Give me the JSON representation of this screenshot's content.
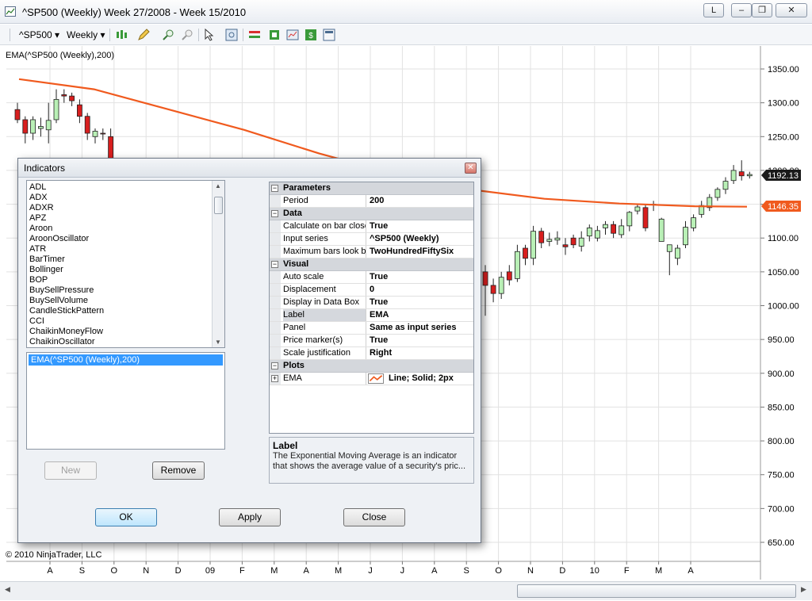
{
  "window": {
    "title": "^SP500 (Weekly)  Week 27/2008 - Week 15/2010",
    "btn_layout": "L"
  },
  "toolbar": {
    "instrument": "^SP500",
    "interval": "Weekly"
  },
  "chart": {
    "indicator_label": "EMA(^SP500 (Weekly),200)",
    "copyright": "© 2010 NinjaTrader, LLC",
    "last_price": "1192.13",
    "ema_value": "1146.35",
    "colors": {
      "up": "#b9f0b6",
      "down": "#d81e1e",
      "ema": "#f05a1e",
      "grid": "#e2e2e2"
    }
  },
  "chart_data": {
    "type": "candlestick",
    "ylim": [
      625,
      1375
    ],
    "yticks": [
      "1350.00",
      "1300.00",
      "1250.00",
      "1200.00",
      "1150.00",
      "1100.00",
      "1050.00",
      "1000.00",
      "950.00",
      "900.00",
      "850.00",
      "800.00",
      "750.00",
      "700.00",
      "650.00"
    ],
    "xticks": [
      "A",
      "S",
      "O",
      "N",
      "D",
      "09",
      "F",
      "M",
      "A",
      "M",
      "J",
      "J",
      "A",
      "S",
      "O",
      "N",
      "D",
      "10",
      "F",
      "M",
      "A"
    ],
    "visible_candles": {
      "open": [
        1290,
        1275,
        1255,
        1262,
        1260,
        1275,
        1312,
        1310,
        1297,
        1280,
        1250,
        1255,
        1250,
        1050,
        1030,
        1018,
        1050,
        1040,
        1085,
        1070,
        1110,
        1095,
        1097,
        1090,
        1100,
        1088,
        1103,
        1100,
        1115,
        1120,
        1105,
        1118,
        1140,
        1145,
        1150,
        1095,
        1080,
        1070,
        1090,
        1115,
        1135,
        1145,
        1160,
        1172,
        1185,
        1198,
        1192
      ],
      "close": [
        1275,
        1255,
        1275,
        1265,
        1274,
        1305,
        1310,
        1303,
        1280,
        1255,
        1258,
        1254,
        1200,
        1030,
        1018,
        1042,
        1038,
        1080,
        1070,
        1110,
        1093,
        1098,
        1100,
        1087,
        1090,
        1100,
        1115,
        1111,
        1120,
        1107,
        1118,
        1138,
        1146,
        1115,
        1150,
        1128,
        1090,
        1085,
        1116,
        1130,
        1148,
        1160,
        1172,
        1184,
        1200,
        1192,
        1194
      ],
      "high": [
        1300,
        1280,
        1280,
        1278,
        1300,
        1320,
        1320,
        1315,
        1305,
        1285,
        1262,
        1262,
        1262,
        1060,
        1040,
        1050,
        1060,
        1090,
        1090,
        1118,
        1115,
        1108,
        1110,
        1100,
        1105,
        1110,
        1120,
        1118,
        1125,
        1125,
        1128,
        1140,
        1150,
        1150,
        1155,
        1130,
        1090,
        1090,
        1125,
        1135,
        1155,
        1165,
        1175,
        1190,
        1208,
        1215,
        1198
      ],
      "low": [
        1270,
        1240,
        1245,
        1250,
        1240,
        1270,
        1300,
        1295,
        1270,
        1245,
        1240,
        1245,
        1195,
        985,
        1005,
        1010,
        1030,
        1035,
        1060,
        1060,
        1085,
        1088,
        1090,
        1075,
        1085,
        1080,
        1095,
        1095,
        1105,
        1100,
        1100,
        1110,
        1135,
        1110,
        1140,
        1095,
        1045,
        1060,
        1085,
        1110,
        1130,
        1140,
        1155,
        1165,
        1180,
        1185,
        1188
      ]
    },
    "ema": {
      "x": [
        0,
        10,
        20,
        30,
        40,
        50,
        60,
        70,
        80,
        90,
        97
      ],
      "y": [
        1335,
        1320,
        1290,
        1260,
        1225,
        1195,
        1172,
        1158,
        1151,
        1147,
        1146.35
      ]
    }
  },
  "dialog": {
    "title": "Indicators",
    "indicators": [
      "ADL",
      "ADX",
      "ADXR",
      "APZ",
      "Aroon",
      "AroonOscillator",
      "ATR",
      "BarTimer",
      "Bollinger",
      "BOP",
      "BuySellPressure",
      "BuySellVolume",
      "CandleStickPattern",
      "CCI",
      "ChaikinMoneyFlow",
      "ChaikinOscillator"
    ],
    "applied": [
      "EMA(^SP500 (Weekly),200)"
    ],
    "buttons": {
      "new": "New",
      "remove": "Remove",
      "ok": "OK",
      "apply": "Apply",
      "close": "Close"
    },
    "properties": [
      {
        "category": "Parameters"
      },
      {
        "name": "Period",
        "value": "200"
      },
      {
        "category": "Data"
      },
      {
        "name": "Calculate on bar close",
        "value": "True"
      },
      {
        "name": "Input series",
        "value": "^SP500 (Weekly)"
      },
      {
        "name": "Maximum bars look back",
        "value": "TwoHundredFiftySix"
      },
      {
        "category": "Visual"
      },
      {
        "name": "Auto scale",
        "value": "True"
      },
      {
        "name": "Displacement",
        "value": "0"
      },
      {
        "name": "Display in Data Box",
        "value": "True"
      },
      {
        "name": "Label",
        "value": "EMA",
        "selected": true
      },
      {
        "name": "Panel",
        "value": "Same as input series"
      },
      {
        "name": "Price marker(s)",
        "value": "True"
      },
      {
        "name": "Scale justification",
        "value": "Right"
      },
      {
        "category": "Plots"
      },
      {
        "name": "EMA",
        "value": "Line; Solid; 2px",
        "expandable": true,
        "swatch": true
      }
    ],
    "help_title": "Label",
    "help_text": "The Exponential Moving Average is an indicator that shows the average value of a security's pric..."
  }
}
